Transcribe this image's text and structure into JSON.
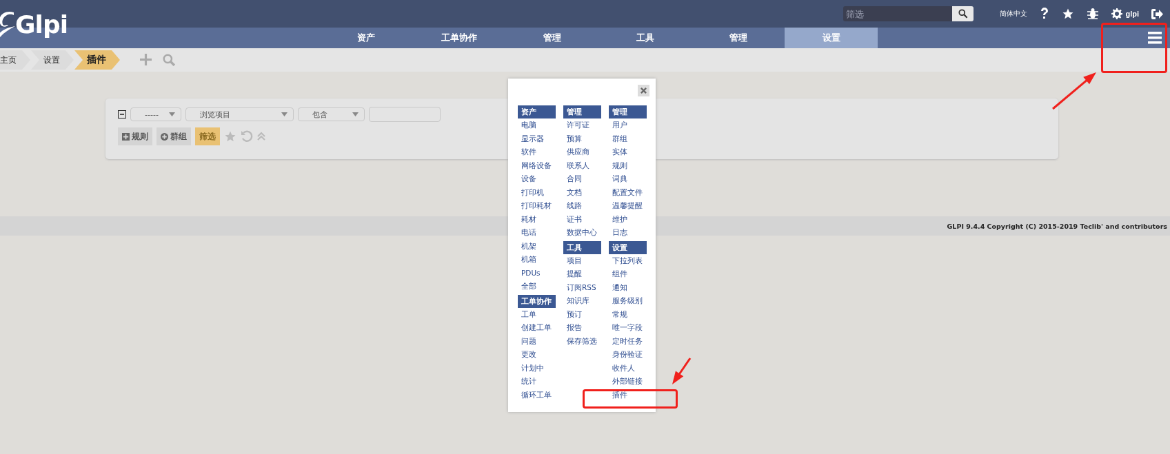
{
  "logo": {
    "text": "Glpi"
  },
  "top_bar": {
    "search": {
      "placeholder": "筛选"
    },
    "language": "简体中文",
    "user": "glpi"
  },
  "nav_tabs": [
    {
      "label": "资产",
      "selected": false
    },
    {
      "label": "工单协作",
      "selected": false
    },
    {
      "label": "管理",
      "selected": false
    },
    {
      "label": "工具",
      "selected": false
    },
    {
      "label": "管理",
      "selected": false
    },
    {
      "label": "设置",
      "selected": true
    }
  ],
  "breadcrumbs": [
    {
      "label": "主页",
      "selected": false
    },
    {
      "label": "设置",
      "selected": false
    },
    {
      "label": "插件",
      "selected": true
    }
  ],
  "search_panel": {
    "field_1": "-----",
    "field_2": "浏览项目",
    "field_3": "包含",
    "buttons": [
      "规则",
      "群组",
      "筛选"
    ]
  },
  "menu_popup": {
    "columns": [
      [
        {
          "title": "资产",
          "items": [
            "电脑",
            "显示器",
            "软件",
            "网络设备",
            "设备",
            "打印机",
            "打印耗材",
            "耗材",
            "电话",
            "机架",
            "机箱",
            "PDUs",
            "全部"
          ]
        },
        {
          "title": "工单协作",
          "items": [
            "工单",
            "创建工单",
            "问题",
            "更改",
            "计划中",
            "统计",
            "循环工单"
          ]
        }
      ],
      [
        {
          "title": "管理",
          "items": [
            "许可证",
            "预算",
            "供应商",
            "联系人",
            "合同",
            "文档",
            "线路",
            "证书",
            "数据中心"
          ]
        },
        {
          "title": "工具",
          "items": [
            "项目",
            "提醒",
            "订阅RSS",
            "知识库",
            "预订",
            "报告",
            "保存筛选"
          ]
        }
      ],
      [
        {
          "title": "管理",
          "items": [
            "用户",
            "群组",
            "实体",
            "规则",
            "词典",
            "配置文件",
            "温馨提醒",
            "维护",
            "日志"
          ]
        },
        {
          "title": "设置",
          "items": [
            "下拉列表",
            "组件",
            "通知",
            "服务级别",
            "常规",
            "唯一字段",
            "定时任务",
            "身份验证",
            "收件人",
            "外部链接",
            "插件"
          ]
        }
      ]
    ]
  },
  "footer": "GLPI 9.4.4 Copyright (C) 2015-2019 Teclib' and contributors",
  "annotations": [
    {
      "kind": "box"
    },
    {
      "kind": "arrow"
    },
    {
      "kind": "box"
    },
    {
      "kind": "arrow"
    }
  ]
}
